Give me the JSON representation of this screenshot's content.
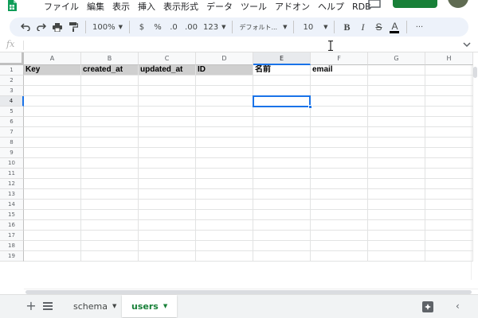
{
  "menu": {
    "items": [
      "ファイル",
      "編集",
      "表示",
      "挿入",
      "表示形式",
      "データ",
      "ツール",
      "アドオン",
      "ヘルプ",
      "RDB"
    ]
  },
  "toolbar": {
    "zoom": "100%",
    "currency": "$",
    "percent": "%",
    "decrease_decimal": ".0",
    "increase_decimal": ".00",
    "more_formats": "123",
    "font": "デフォルト...",
    "font_size": "10",
    "bold": "B",
    "italic": "I",
    "strikethrough": "S",
    "text_color": "A",
    "more": "···"
  },
  "formula_bar": {
    "fx": "fx",
    "value": ""
  },
  "grid": {
    "columns": [
      "A",
      "B",
      "C",
      "D",
      "E",
      "F",
      "G",
      "H"
    ],
    "rows": [
      "1",
      "2",
      "3",
      "4",
      "5",
      "6",
      "7",
      "8",
      "9",
      "10",
      "11",
      "12",
      "13",
      "14",
      "15",
      "16",
      "17",
      "18",
      "19"
    ],
    "row1": [
      "Key",
      "created_at",
      "updated_at",
      "ID",
      "名前",
      "email",
      "",
      ""
    ],
    "active_column": "E",
    "active_row": "4"
  },
  "sheets": {
    "tabs": [
      {
        "label": "schema",
        "active": false
      },
      {
        "label": "users",
        "active": true
      }
    ]
  },
  "colors": {
    "accent": "#1a73e8",
    "brand_green": "#188038",
    "header_gray": "#cfcfcf"
  }
}
